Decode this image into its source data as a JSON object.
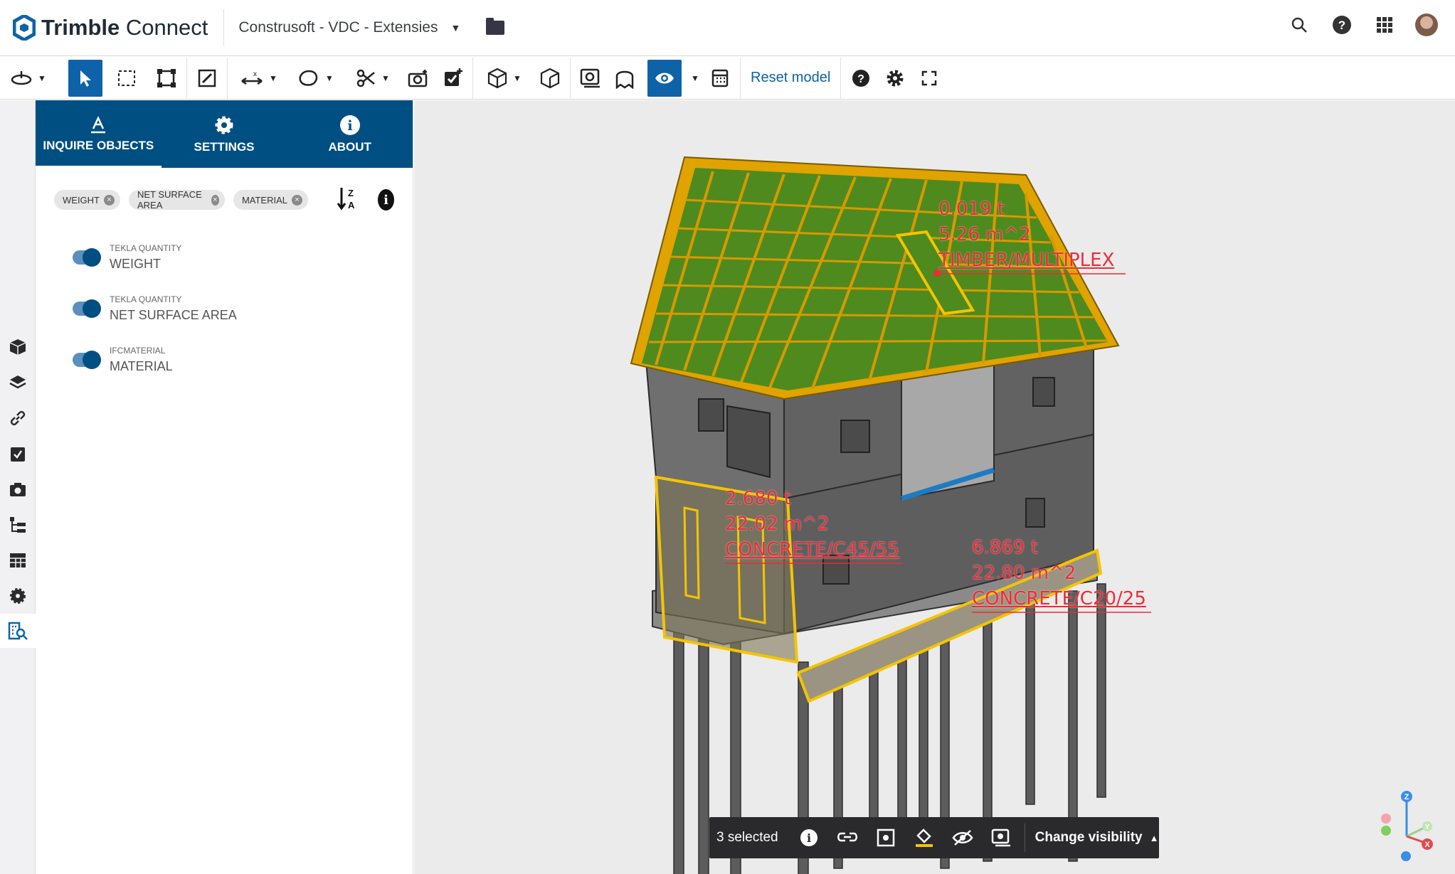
{
  "app": {
    "brand_name": "Trimble",
    "brand_suffix": "Connect",
    "project_name": "Construsoft - VDC - Extensies"
  },
  "header": {
    "icons": [
      "search-icon",
      "help-icon",
      "apps-grid-icon",
      "user-avatar"
    ]
  },
  "toolbar": {
    "reset_label": "Reset model"
  },
  "panel": {
    "tabs": [
      {
        "label": "INQUIRE OBJECTS",
        "icon": "inquire-icon",
        "active": true
      },
      {
        "label": "SETTINGS",
        "icon": "gear-icon",
        "active": false
      },
      {
        "label": "ABOUT",
        "icon": "info-icon",
        "active": false
      }
    ],
    "chips": [
      "WEIGHT",
      "NET SURFACE AREA",
      "MATERIAL"
    ],
    "properties": [
      {
        "category": "TEKLA QUANTITY",
        "name": "WEIGHT",
        "enabled": true
      },
      {
        "category": "TEKLA QUANTITY",
        "name": "NET SURFACE AREA",
        "enabled": true
      },
      {
        "category": "IFCMATERIAL",
        "name": "MATERIAL",
        "enabled": true
      }
    ]
  },
  "labels": [
    {
      "weight": "0.019 t",
      "area": "5.26 m^2",
      "material": "TIMBER/MULTIPLEX"
    },
    {
      "weight": "2.680 t",
      "area": "22.02 m^2",
      "material": "CONCRETE/C45/55"
    },
    {
      "weight": "6.869 t",
      "area": "22.80 m^2",
      "material": "CONCRETE/C20/25"
    }
  ],
  "selection_bar": {
    "count_label": "3 selected",
    "visibility_label": "Change visibility"
  },
  "colors": {
    "brand_blue": "#004f83",
    "active_tool": "#0e63a8",
    "label_red": "#f02b35",
    "selection_yellow": "#f4c400"
  }
}
